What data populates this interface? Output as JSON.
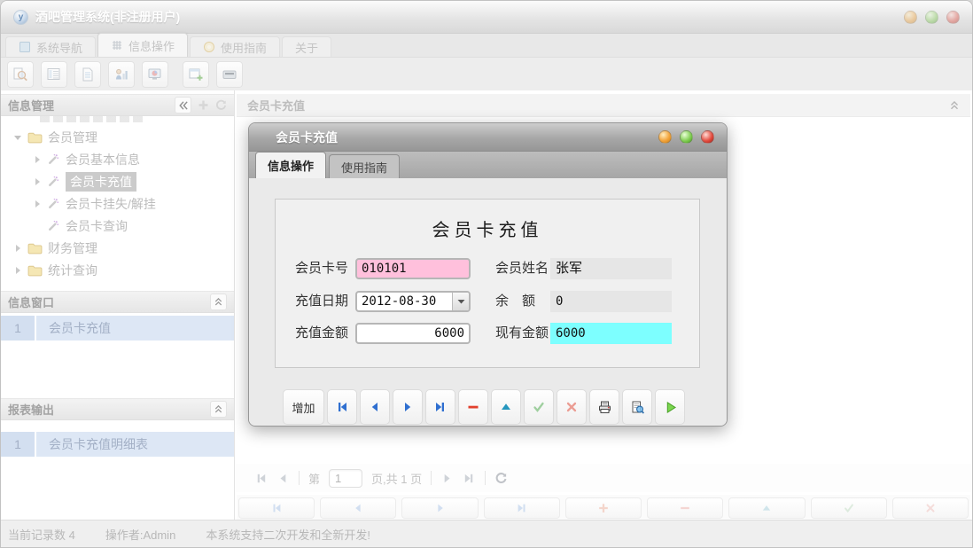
{
  "window": {
    "title": "酒吧管理系统(非注册用户)"
  },
  "tabs": [
    {
      "label": "系统导航"
    },
    {
      "label": "信息操作"
    },
    {
      "label": "使用指南"
    },
    {
      "label": "关于"
    }
  ],
  "sidebar": {
    "info_panel_title": "信息管理",
    "tree": [
      {
        "label": "会员管理"
      },
      {
        "label": "会员基本信息"
      },
      {
        "label": "会员卡充值"
      },
      {
        "label": "会员卡挂失/解挂"
      },
      {
        "label": "会员卡查询"
      },
      {
        "label": "财务管理"
      },
      {
        "label": "统计查询"
      }
    ],
    "windows_panel": {
      "title": "信息窗口",
      "rows": [
        {
          "num": "1",
          "label": "会员卡充值"
        }
      ]
    },
    "reports_panel": {
      "title": "报表输出",
      "rows": [
        {
          "num": "1",
          "label": "会员卡充值明细表"
        }
      ]
    }
  },
  "main": {
    "header_title": "会员卡充值"
  },
  "dialog": {
    "title": "会员卡充值",
    "tabs": [
      {
        "label": "信息操作"
      },
      {
        "label": "使用指南"
      }
    ],
    "form": {
      "title": "会员卡充值",
      "card_no_label": "会员卡号",
      "card_no_value": "010101",
      "member_name_label": "会员姓名",
      "member_name_value": "张军",
      "date_label": "充值日期",
      "date_value": "2012-08-30",
      "balance_label": "余　额",
      "balance_value": "0",
      "amount_label": "充值金额",
      "amount_value": "6000",
      "current_label": "现有金额",
      "current_value": "6000"
    },
    "toolbar": {
      "add_label": "增加"
    }
  },
  "pagination": {
    "page_prefix": "第",
    "page_value": "1",
    "page_suffix": "页,共 1 页"
  },
  "statusbar": {
    "record_count": "当前记录数 4",
    "operator": "操作者:Admin",
    "message": "本系统支持二次开发和全新开发!"
  },
  "icons": {
    "window_controls": [
      "minimize",
      "maximize",
      "close"
    ],
    "sidebar_header": [
      "collapse-left",
      "add",
      "refresh"
    ],
    "dialog_toolbar": [
      "first",
      "prev",
      "next",
      "last",
      "delete",
      "up",
      "confirm",
      "cancel",
      "print",
      "print-preview",
      "run"
    ],
    "pagination": [
      "first",
      "prev",
      "next",
      "last",
      "refresh"
    ],
    "bottom_toolbar": [
      "first",
      "prev",
      "next",
      "last",
      "add",
      "delete",
      "up",
      "confirm",
      "cancel"
    ]
  },
  "colors": {
    "field_pink": "#ffc0dc",
    "field_cyan": "#7dffff",
    "field_gray": "#e6e6e6",
    "accent_blue": "#2f6fd0",
    "danger_red": "#e2402e",
    "teal": "#2596be",
    "run_green": "#7bd64f"
  }
}
